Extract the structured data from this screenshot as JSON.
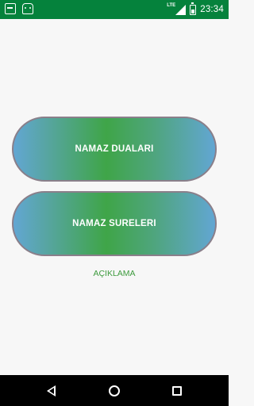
{
  "status_bar": {
    "time": "23:34",
    "network": "LTE",
    "notification_icons": [
      "flat-notification-icon",
      "android-robot-icon"
    ],
    "icons": [
      "signal-icon",
      "battery-icon"
    ]
  },
  "main": {
    "buttons": [
      {
        "label": "NAMAZ DUALARI"
      },
      {
        "label": "NAMAZ SURELERI"
      }
    ],
    "link": {
      "label": "AÇIKLAMA"
    }
  },
  "colors": {
    "status_bar": "#05823c",
    "gradient_green": "#3fa548",
    "gradient_blue": "#62a6d3",
    "button_border": "#8a7f8a",
    "link_text": "#3e9b3e",
    "background": "#f7f7f7"
  },
  "nav_bar": {
    "icons": [
      "back-icon",
      "home-icon",
      "recents-icon"
    ]
  }
}
